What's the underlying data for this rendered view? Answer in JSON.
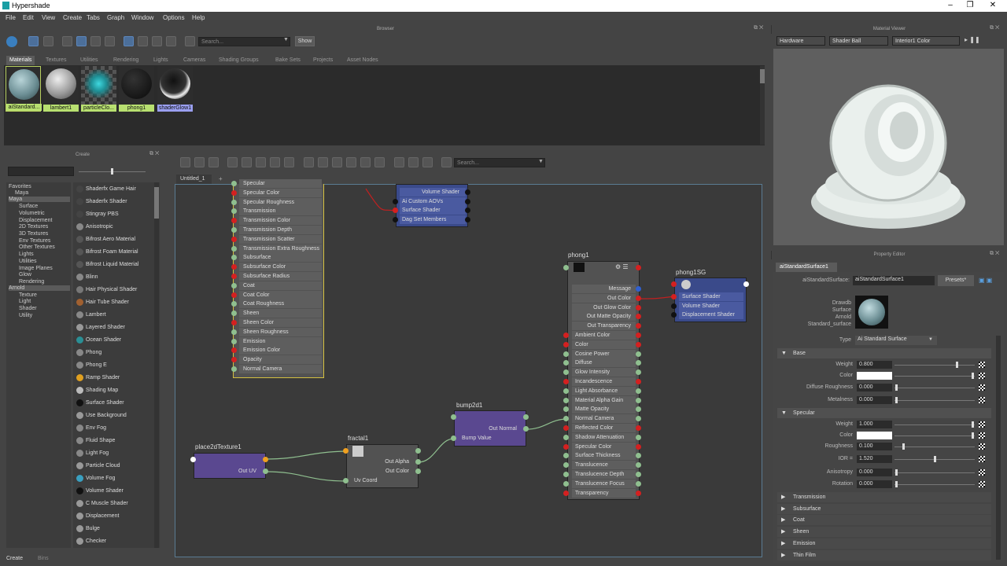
{
  "window": {
    "title": "Hypershade",
    "controls": [
      "–",
      "❐",
      "✕"
    ]
  },
  "menu": [
    "File",
    "Edit",
    "View",
    "Create",
    "Tabs",
    "Graph",
    "Window",
    "Options",
    "Help"
  ],
  "browser": {
    "title": "Browser",
    "search_placeholder": "Search...",
    "show_label": "Show",
    "tabs": [
      "Materials",
      "Textures",
      "Utilities",
      "Rendering",
      "Lights",
      "Cameras",
      "Shading Groups",
      "Bake Sets",
      "Projects",
      "Asset Nodes"
    ],
    "materials": [
      {
        "name": "aiStandard...",
        "ball": "#6d8f95"
      },
      {
        "name": "lambert1",
        "ball": "#9a9a9a"
      },
      {
        "name": "particleClo...",
        "ball": "#1e8f95"
      },
      {
        "name": "phong1",
        "ball": "#222222"
      },
      {
        "name": "shaderGlow1",
        "ball": "#777777"
      }
    ]
  },
  "matviewer": {
    "title": "Material Viewer",
    "renderer": "Hardware",
    "shape": "Shader Ball",
    "env": "Interior1 Color"
  },
  "create": {
    "title": "Create",
    "tree": [
      "Favorites",
      "Maya",
      "Maya",
      "Surface",
      "Volumetric",
      "Displacement",
      "2D Textures",
      "3D Textures",
      "Env Textures",
      "Other Textures",
      "Lights",
      "Utilities",
      "Image Planes",
      "Glow",
      "Rendering",
      "Arnold",
      "Texture",
      "Light",
      "Shader",
      "Utility"
    ],
    "shaders": [
      "Shaderfx Game Hair",
      "Shaderfx Shader",
      "Stingray PBS",
      "Anisotropic",
      "Bifrost Aero Material",
      "Bifrost Foam Material",
      "Bifrost Liquid Material",
      "Blinn",
      "Hair Physical Shader",
      "Hair Tube Shader",
      "Lambert",
      "Layered Shader",
      "Ocean Shader",
      "Phong",
      "Phong E",
      "Ramp Shader",
      "Shading Map",
      "Surface Shader",
      "Use Background",
      "Env Fog",
      "Fluid Shape",
      "Light Fog",
      "Particle Cloud",
      "Volume Fog",
      "Volume Shader",
      "C Muscle Shader",
      "Displacement",
      "Bulge",
      "Checker"
    ],
    "bottom_tabs": [
      "Create",
      "Bins"
    ]
  },
  "graph": {
    "tab": "Untitled_1",
    "add": "+",
    "search_placeholder": "Search...",
    "aistd_rows": [
      "Specular",
      "Specular Color",
      "Specular Roughness",
      "Transmission",
      "Transmission Color",
      "Transmission Depth",
      "Transmission Scatter",
      "Transmission Extra Roughness",
      "Subsurface",
      "Subsurface Color",
      "Subsurface Radius",
      "Coat",
      "Coat Color",
      "Coat Roughness",
      "Sheen",
      "Sheen Color",
      "Sheen Roughness",
      "Emission",
      "Emission Color",
      "Opacity",
      "Normal Camera"
    ],
    "sg_top_rows": [
      "Volume Shader",
      "Ai Custom AOVs",
      "Surface Shader",
      "Dag Set Members"
    ],
    "phong": {
      "name": "phong1",
      "rows": [
        "Message",
        "Out Color",
        "Out Glow Color",
        "Out Matte Opacity",
        "Out Transparency",
        "Ambient Color",
        "Color",
        "Cosine Power",
        "Diffuse",
        "Glow Intensity",
        "Incandescence",
        "Light Absorbance",
        "Material Alpha Gain",
        "Matte Opacity",
        "Normal Camera",
        "Reflected Color",
        "Shadow Attenuation",
        "Specular Color",
        "Surface Thickness",
        "Translucence",
        "Translucence Depth",
        "Translucence Focus",
        "Transparency"
      ]
    },
    "phongsg": {
      "name": "phong1SG",
      "rows": [
        "Surface Shader",
        "Volume Shader",
        "Displacement Shader"
      ]
    },
    "bump": {
      "name": "bump2d1",
      "rows": [
        "Out Normal",
        "Bump Value"
      ]
    },
    "fractal": {
      "name": "fractal1",
      "rows": [
        "Out Alpha",
        "Out Color",
        "Uv Coord"
      ]
    },
    "place2d": {
      "name": "place2dTexture1",
      "rows": [
        "Out UV"
      ]
    }
  },
  "props": {
    "title": "Property Editor",
    "tab": "aiStandardSurface1",
    "label": "aiStandardSurface:",
    "value": "aiStandardSurface1",
    "presets": "Presets*",
    "thumb_lines": [
      "Drawdb",
      "Surface",
      "Arnold",
      "Standard_surface"
    ],
    "type_label": "Type",
    "type_value": "Ai Standard Surface",
    "base": {
      "title": "Base",
      "weight_l": "Weight",
      "weight": "0.800",
      "color_l": "Color",
      "diffrough_l": "Diffuse Roughness",
      "diffrough": "0.000",
      "metal_l": "Metalness",
      "metal": "0.000"
    },
    "spec": {
      "title": "Specular",
      "weight_l": "Weight",
      "weight": "1.000",
      "color_l": "Color",
      "rough_l": "Roughness",
      "rough": "0.100",
      "ior_l": "IOR =",
      "ior": "1.520",
      "aniso_l": "Anisotropy",
      "aniso": "0.000",
      "rot_l": "Rotation",
      "rot": "0.000"
    },
    "closed": [
      "Transmission",
      "Subsurface",
      "Coat",
      "Sheen",
      "Emission",
      "Thin Film"
    ]
  }
}
